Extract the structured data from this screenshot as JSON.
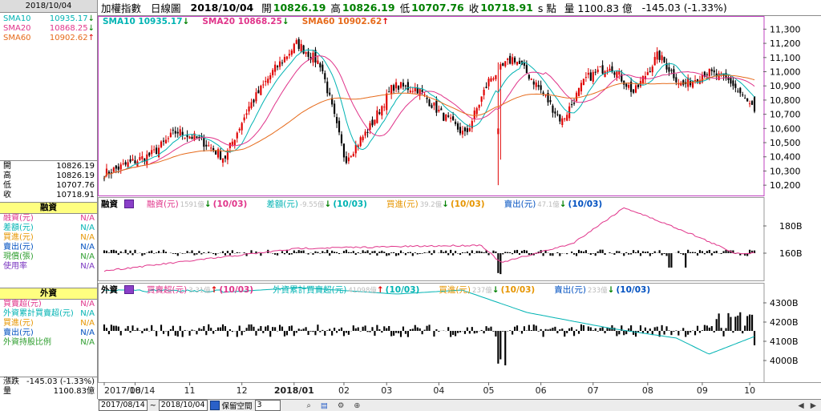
{
  "left_panel": {
    "date": "2018/10/04",
    "sma": [
      {
        "label": "SMA10",
        "value": "10935.17",
        "arrow": "down",
        "color": "#00b3b3"
      },
      {
        "label": "SMA20",
        "value": "10868.25",
        "arrow": "down",
        "color": "#e0348a"
      },
      {
        "label": "SMA60",
        "value": "10902.62",
        "arrow": "up",
        "color": "#e66a1a"
      }
    ],
    "ohlc": [
      {
        "label": "開",
        "value": "10826.19"
      },
      {
        "label": "高",
        "value": "10826.19"
      },
      {
        "label": "低",
        "value": "10707.76"
      },
      {
        "label": "收",
        "value": "10718.91"
      }
    ],
    "margin_title": "融資",
    "margin_rows": [
      {
        "label": "融資(元)",
        "value": "N/A",
        "color": "#e0348a"
      },
      {
        "label": "差額(元)",
        "value": "N/A",
        "color": "#00b3b3"
      },
      {
        "label": "買進(元)",
        "value": "N/A",
        "color": "#e69500"
      },
      {
        "label": "賣出(元)",
        "value": "N/A",
        "color": "#0050c0"
      },
      {
        "label": "現償(張)",
        "value": "N/A",
        "color": "#2e9e2e"
      },
      {
        "label": "使用率",
        "value": "N/A",
        "color": "#7a35c0"
      }
    ],
    "foreign_title": "外資",
    "foreign_rows": [
      {
        "label": "買賣超(元)",
        "value": "N/A",
        "color": "#e0348a"
      },
      {
        "label": "外資累計買賣超(元)",
        "value": "N/A",
        "color": "#00b3b3"
      },
      {
        "label": "買進(元)",
        "value": "N/A",
        "color": "#e69500"
      },
      {
        "label": "賣出(元)",
        "value": "N/A",
        "color": "#0050c0"
      },
      {
        "label": "外資持股比例",
        "value": "N/A",
        "color": "#2e9e2e"
      }
    ],
    "change_label": "漲跌",
    "change_value": "-145.03 (-1.33%)",
    "volume_label": "量",
    "volume_value": "1100.83億"
  },
  "top_bar": {
    "index_name": "加權指數",
    "period": "日線圖",
    "date": "2018/10/04",
    "open_label": "開",
    "open": "10826.19",
    "high_label": "高",
    "high": "10826.19",
    "low_label": "低",
    "low": "10707.76",
    "close_label": "收",
    "close": "10718.91",
    "unit": "s 點",
    "volume_label": "量",
    "volume": "1100.83 億",
    "change": "-145.03 (-1.33%)"
  },
  "price_legend": [
    {
      "text": "SMA10 10935.17",
      "arrow": "↓",
      "color": "#00b3b3",
      "arrow_color": "#008000"
    },
    {
      "text": "SMA20 10868.25",
      "arrow": "↓",
      "color": "#e0348a",
      "arrow_color": "#008000"
    },
    {
      "text": "SMA60 10902.62",
      "arrow": "↑",
      "color": "#e66a1a",
      "arrow_color": "#e00000"
    }
  ],
  "margin_legend": {
    "title": "融資",
    "items": [
      {
        "label": "融資(元)",
        "value": "1591億",
        "arrow": "↓",
        "date": "(10/03)",
        "color": "#e0348a",
        "arrow_color": "#008000"
      },
      {
        "label": "差額(元)",
        "value": "-9.55億",
        "arrow": "↓",
        "date": "(10/03)",
        "color": "#00b3b3",
        "arrow_color": "#008000"
      },
      {
        "label": "買進(元)",
        "value": "39.2億",
        "arrow": "↓",
        "date": "(10/03)",
        "color": "#e69500",
        "arrow_color": "#008000"
      },
      {
        "label": "賣出(元)",
        "value": "47.1億",
        "arrow": "↓",
        "date": "(10/03)",
        "color": "#0050c0",
        "arrow_color": "#008000"
      }
    ]
  },
  "foreign_legend": {
    "title": "外資",
    "items": [
      {
        "label": "買賣超(元)",
        "value": "3.31億",
        "arrow": "↑",
        "date": "(10/03)",
        "color": "#e0348a",
        "arrow_color": "#e00000"
      },
      {
        "label": "外資累計買賣超(元)",
        "value": "41098億",
        "arrow": "↑",
        "date": "(10/03)",
        "color": "#00b3b3",
        "arrow_color": "#e00000"
      },
      {
        "label": "買進(元)",
        "value": "237億",
        "arrow": "↓",
        "date": "(10/03)",
        "color": "#e69500",
        "arrow_color": "#008000"
      },
      {
        "label": "賣出(元)",
        "value": "233億",
        "arrow": "↓",
        "date": "(10/03)",
        "color": "#0050c0",
        "arrow_color": "#008000"
      }
    ]
  },
  "bottom_bar": {
    "start": "2017/08/14",
    "sep": "~",
    "end": "2018/10/04",
    "keep_label": "保留空間",
    "keep_value": "3"
  },
  "chart_data": [
    {
      "type": "candlestick",
      "title": "加權指數 日線圖",
      "y_ticks": [
        10200,
        10300,
        10400,
        10500,
        10600,
        10700,
        10800,
        10900,
        11000,
        11100,
        11200,
        11300
      ],
      "ylim": [
        10150,
        11370
      ],
      "x_ticks": [
        "2017/08/14",
        "10",
        "11",
        "12",
        "2018/01",
        "02",
        "03",
        "04",
        "05",
        "06",
        "07",
        "08",
        "09",
        "10"
      ],
      "colors": {
        "up": "#e00000",
        "down": "#000000",
        "sma10": "#00b3b3",
        "sma20": "#e0348a",
        "sma60": "#e66a1a"
      },
      "monthly_path_close": [
        10280,
        10350,
        10420,
        10580,
        10520,
        10390,
        10750,
        11000,
        11200,
        11050,
        10380,
        10600,
        10900,
        10880,
        10700,
        10550,
        10950,
        11100,
        10900,
        10650,
        10950,
        11050,
        10850,
        11120,
        10900,
        11000,
        10930,
        10718.91
      ],
      "sma10_last": 10935.17,
      "sma20_last": 10868.25,
      "sma60_last": 10902.62
    },
    {
      "type": "bar",
      "title": "融資",
      "y_ticks": [
        "180B",
        "160B"
      ],
      "series": [
        {
          "name": "融資(元)",
          "last": "1591億"
        },
        {
          "name": "差額(元)",
          "last": "-9.55億"
        },
        {
          "name": "買進(元)",
          "last": "39.2億"
        },
        {
          "name": "賣出(元)",
          "last": "47.1億"
        }
      ]
    },
    {
      "type": "bar",
      "title": "外資",
      "y_ticks": [
        "4300B",
        "4200B",
        "4100B",
        "4000B"
      ],
      "series": [
        {
          "name": "買賣超(元)",
          "last": "3.31億"
        },
        {
          "name": "外資累計買賣超(元)",
          "last": "41098億"
        },
        {
          "name": "買進(元)",
          "last": "237億"
        },
        {
          "name": "賣出(元)",
          "last": "233億"
        }
      ]
    }
  ]
}
